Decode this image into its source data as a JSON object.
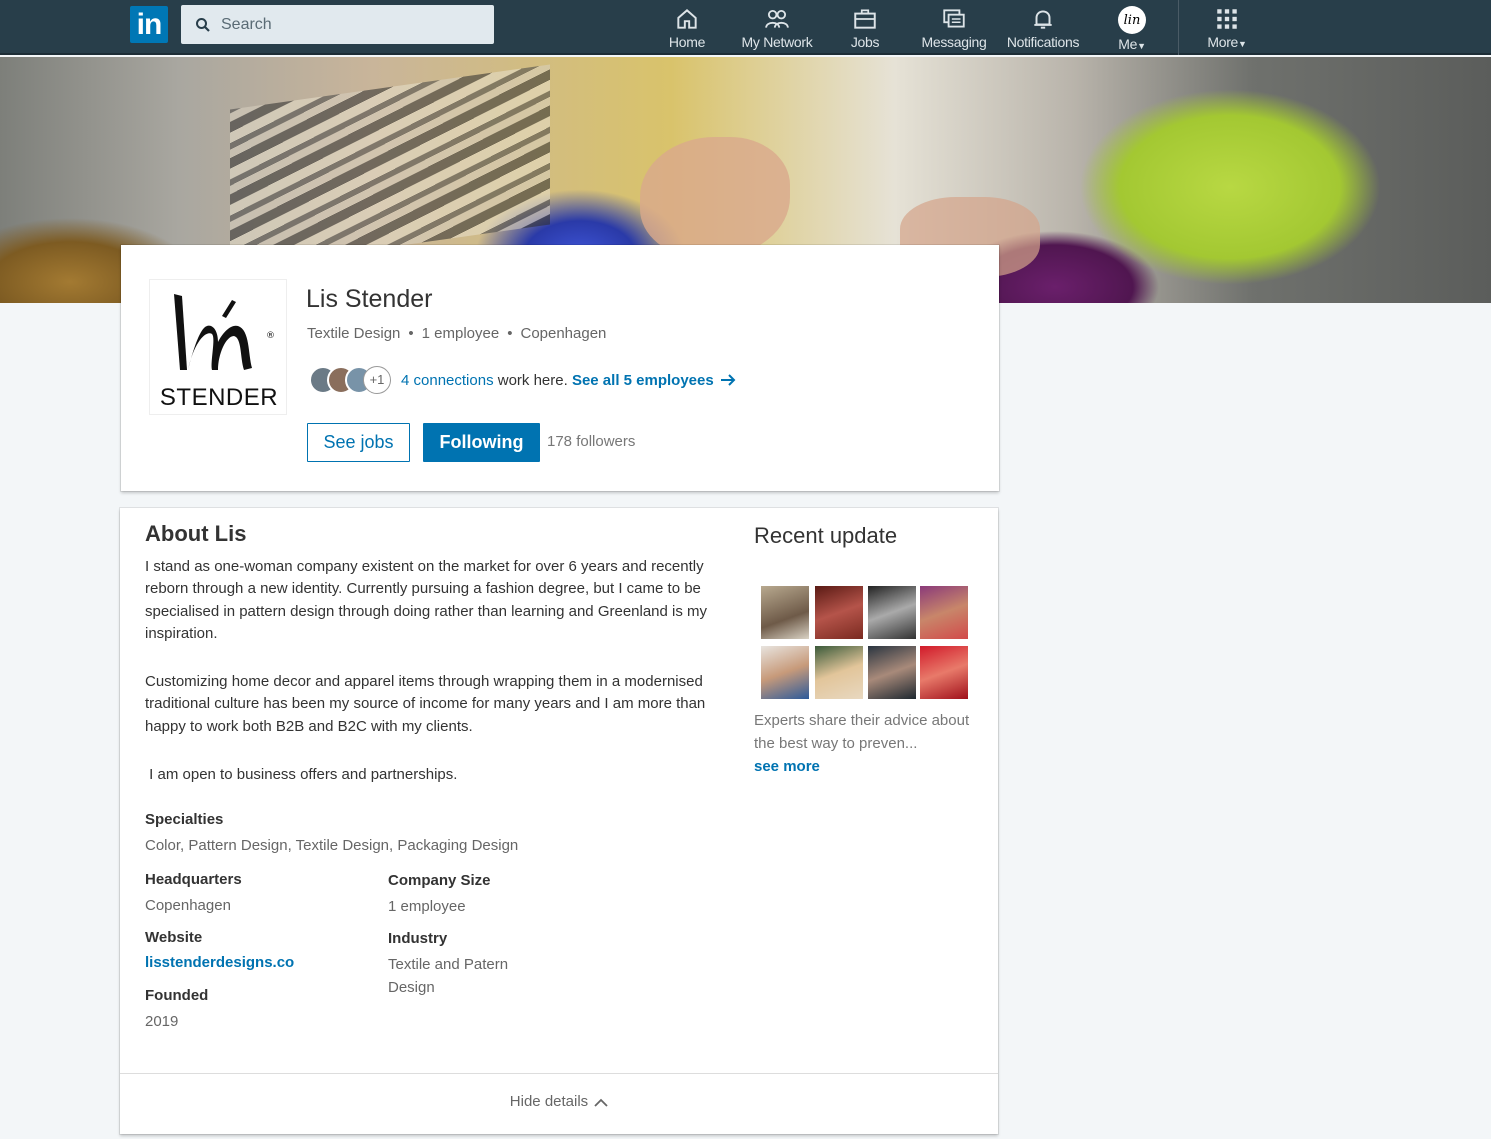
{
  "nav": {
    "logo": "in",
    "search_placeholder": "Search",
    "items": [
      {
        "label": "Home",
        "icon": "home-icon"
      },
      {
        "label": "My Network",
        "icon": "network-icon"
      },
      {
        "label": "Jobs",
        "icon": "briefcase-icon"
      },
      {
        "label": "Messaging",
        "icon": "messaging-icon"
      },
      {
        "label": "Notifications",
        "icon": "bell-icon"
      },
      {
        "label": "Me",
        "icon": "avatar"
      },
      {
        "label": "More",
        "icon": "grid-icon"
      }
    ]
  },
  "company": {
    "logo_word": "STENDER",
    "name": "Lis Stender",
    "industry": "Textile Design",
    "size": "1 employee",
    "location": "Copenhagen",
    "plus_count": "+1",
    "connections_link": "4 connections",
    "connections_text": " work here. ",
    "see_all": "See all 5 employees",
    "see_jobs": "See jobs",
    "following": "Following",
    "followers": "178 followers"
  },
  "about": {
    "title": "About Lis",
    "paragraphs": [
      "I stand as one-woman company existent on the market for over 6 years and recently reborn through a new identity. Currently pursuing a fashion degree, but I came to be specialised in pattern design through doing rather than learning and Greenland is my inspiration.",
      "Customizing home decor and apparel items through wrapping them in a modernised traditional culture has been my source of income for many years and I am more than happy to work both B2B and B2C with my clients.",
      " I am open to business offers and partnerships."
    ],
    "specialties_label": "Specialties",
    "specialties": "Color, Pattern Design, Textile Design, Packaging Design",
    "headquarters_label": "Headquarters",
    "headquarters": "Copenhagen",
    "website_label": "Website",
    "website": "lisstenderdesigns.co",
    "founded_label": "Founded",
    "founded": "2019",
    "company_size_label": "Company Size",
    "company_size": "1 employee",
    "industry_label": "Industry",
    "industry": "Textile and Patern Design",
    "hide_details": "Hide details"
  },
  "recent": {
    "title": "Recent update",
    "text": "Experts share their advice about the best way to preven...",
    "see_more": "see more"
  },
  "colors": {
    "nav_bg": "#283e4a",
    "accent": "#0073b1",
    "page_bg": "#f3f6f8"
  }
}
